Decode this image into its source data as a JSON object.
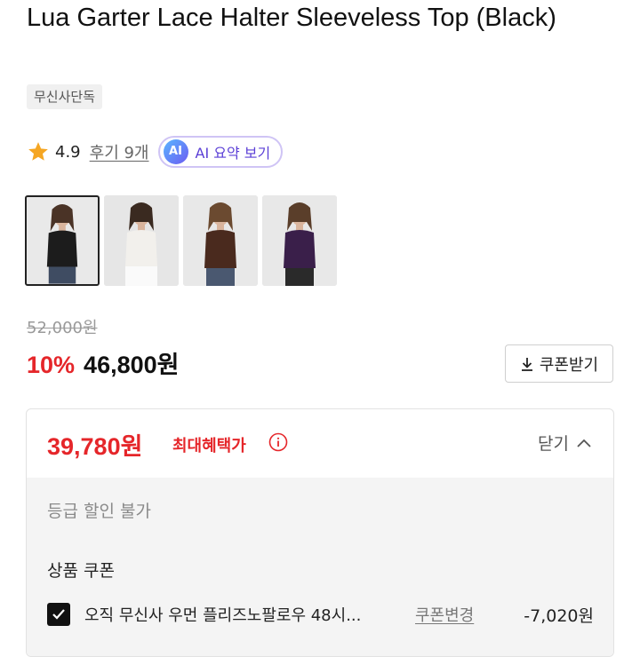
{
  "product": {
    "title": "Lua Garter Lace Halter Sleeveless Top (Black)",
    "badge": "무신사단독",
    "rating": "4.9",
    "reviews_label": "후기 9개",
    "ai_badge": "AI",
    "ai_summary_label": "AI 요약 보기",
    "thumbnails": [
      {
        "name": "black",
        "color": "#1c1c1c"
      },
      {
        "name": "white",
        "color": "#f2f0ec"
      },
      {
        "name": "brown",
        "color": "#4a2a1e"
      },
      {
        "name": "purple",
        "color": "#3a1f4a"
      }
    ],
    "selected_thumbnail": 0
  },
  "pricing": {
    "original_price": "52,000원",
    "discount_rate": "10%",
    "sale_price": "46,800원",
    "coupon_button_label": "쿠폰받기"
  },
  "benefit_panel": {
    "max_price": "39,780원",
    "max_label": "최대혜택가",
    "toggle_label": "닫기",
    "grade_discount_note": "등급 할인 불가",
    "coupon_section_title": "상품 쿠폰",
    "coupon": {
      "checked": true,
      "name": "오직 무신사 우먼 플리즈노팔로우 48시...",
      "change_label": "쿠폰변경",
      "amount": "-7,020원"
    }
  },
  "colors": {
    "accent_red": "#e5262a",
    "ai_purple": "#5b3fd6",
    "star": "#f5a623"
  }
}
